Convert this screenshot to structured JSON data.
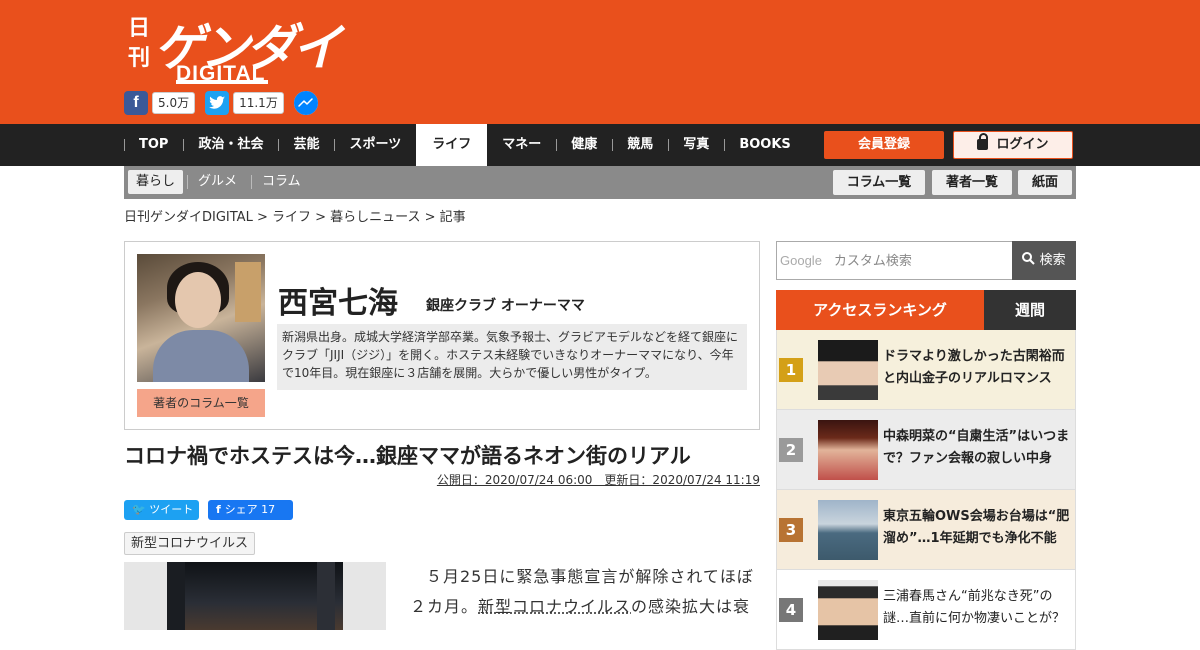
{
  "header": {
    "logo_nikkan": "日刊",
    "logo_gendai": "ゲンダイ",
    "logo_digital": "DIGITAL",
    "facebook_count": "5.0万",
    "twitter_count": "11.1万"
  },
  "gnav": {
    "items": [
      "TOP",
      "政治・社会",
      "芸能",
      "スポーツ",
      "ライフ",
      "マネー",
      "健康",
      "競馬",
      "写真",
      "BOOKS"
    ],
    "register_label": "会員登録",
    "login_label": "ログイン"
  },
  "subnav": {
    "items": [
      "暮らし",
      "グルメ",
      "コラム"
    ],
    "buttons": [
      "コラム一覧",
      "著者一覧",
      "紙面"
    ]
  },
  "breadcrumb": "日刊ゲンダイDIGITAL > ライフ > 暮らしニュース > 記事",
  "author": {
    "name": "西宮七海",
    "role": "銀座クラブ オーナーママ",
    "bio": "新潟県出身。成城大学経済学部卒業。気象予報士、グラビアモデルなどを経て銀座にクラブ「JIJI（ジジ）」を開く。ホステス未経験でいきなりオーナーママになり、今年で10年目。現在銀座に３店舗を展開。大らかで優しい男性がタイプ。",
    "column_link": "著者のコラム一覧"
  },
  "article": {
    "title": "コロナ禍でホステスは今…銀座ママが語るネオン街のリアル",
    "dates": "公開日：2020/07/24 06:00　更新日：2020/07/24 11:19",
    "tweet_label": "ツイート",
    "share_label": "シェア 17",
    "tag": "新型コロナウイルス",
    "body_part1": "５月25日に緊急事態宣言が解除されてほぼ２カ月。",
    "body_link": "新型コロナウイルス",
    "body_part2": "の感染拡大は衰"
  },
  "search": {
    "google_label": "Google",
    "placeholder": "カスタム検索",
    "button_label": "検索"
  },
  "ranking": {
    "title": "アクセスランキング",
    "period": "週間",
    "items": [
      {
        "rank": "1",
        "text": "ドラマより激しかった古閑裕而と内山金子のリアルロマンス",
        "color": "#d4a017"
      },
      {
        "rank": "2",
        "text": "中森明菜の“自粛生活”はいつまで？ファン会報の寂しい中身",
        "color": "#9a9a9a"
      },
      {
        "rank": "3",
        "text": "東京五輪OWS会場お台場は“肥溜め”…1年延期でも浄化不能",
        "color": "#b87333"
      },
      {
        "rank": "4",
        "text": "三浦春馬さん“前兆なき死”の謎…直前に何か物凄いことが？",
        "color": "#777777"
      }
    ]
  }
}
